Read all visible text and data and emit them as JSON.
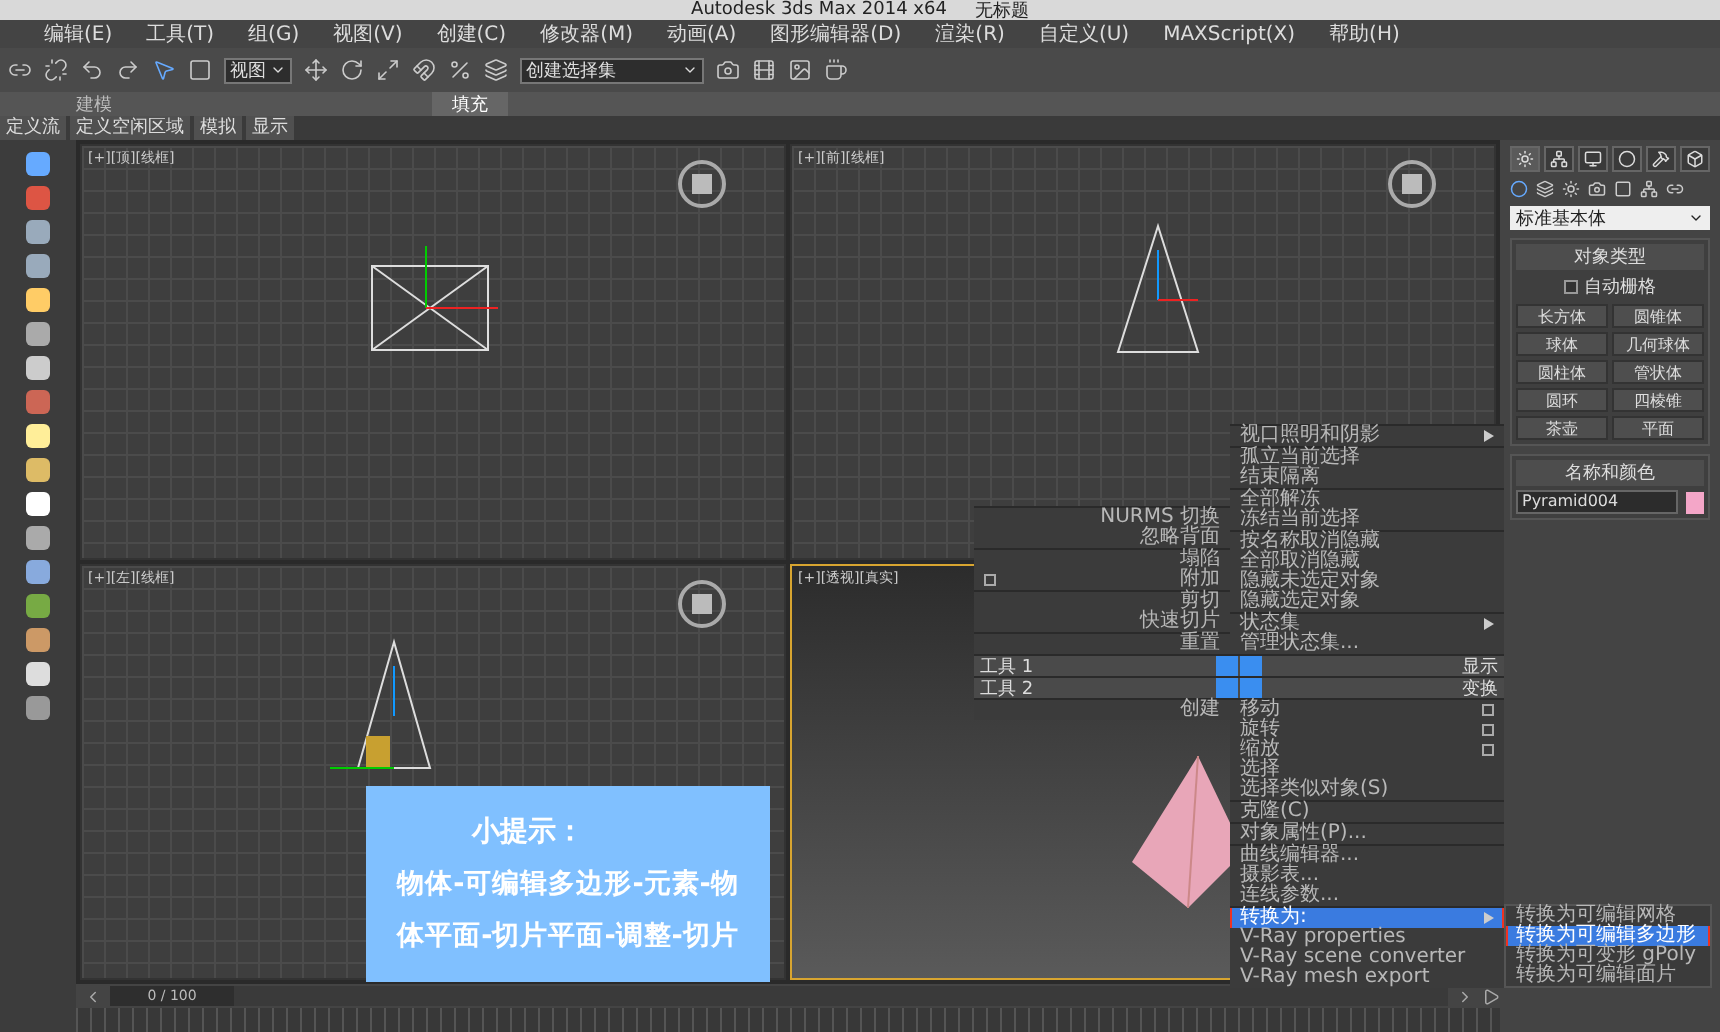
{
  "window": {
    "title": "Autodesk 3ds Max  2014 x64",
    "document": "无标题"
  },
  "menu_bar": [
    "编辑(E)",
    "工具(T)",
    "组(G)",
    "视图(V)",
    "创建(C)",
    "修改器(M)",
    "动画(A)",
    "图形编辑器(D)",
    "渲染(R)",
    "自定义(U)",
    "MAXScript(X)",
    "帮助(H)"
  ],
  "toolbar": {
    "view_dropdown": "视图",
    "selection_set": "创建选择集"
  },
  "ribbon_tabs": [
    {
      "label": "建模",
      "selected": false
    },
    {
      "label": "填充",
      "selected": true
    }
  ],
  "sub_tabs": [
    "定义流",
    "定义空闲区域",
    "模拟",
    "显示"
  ],
  "viewports": [
    {
      "label": "[+][顶][线框]",
      "active": false
    },
    {
      "label": "[+][前][线框]",
      "active": false
    },
    {
      "label": "[+][左][线框]",
      "active": false
    },
    {
      "label": "[+][透视][真实]",
      "active": true
    }
  ],
  "command_panel": {
    "tabs": [
      {
        "selected": true
      },
      {
        "selected": false
      },
      {
        "selected": false
      },
      {
        "selected": false
      },
      {
        "selected": false
      },
      {
        "selected": false
      }
    ],
    "category": "标准基本体",
    "object_type": {
      "title": "对象类型",
      "autogrid": {
        "label": "自动栅格",
        "checked": false
      },
      "buttons": [
        "长方体",
        "圆锥体",
        "球体",
        "几何球体",
        "圆柱体",
        "管状体",
        "圆环",
        "四棱锥",
        "茶壶",
        "平面"
      ]
    },
    "name_color": {
      "title": "名称和颜色",
      "name": "Pyramid004",
      "color": "#f4a6c8"
    }
  },
  "quad_menu": {
    "top_left": [
      [
        {
          "label": "NURMS 切换",
          "kind": "plain"
        },
        {
          "label": "忽略背面",
          "kind": "plain"
        }
      ],
      [
        {
          "label": "塌陷",
          "kind": "plain"
        },
        {
          "label": "附加",
          "kind": "option"
        }
      ],
      [
        {
          "label": "剪切",
          "kind": "plain"
        },
        {
          "label": "快速切片",
          "kind": "plain"
        }
      ],
      [
        {
          "label": "重置",
          "kind": "plain"
        }
      ]
    ],
    "top_right": [
      [
        {
          "label": "视口照明和阴影",
          "kind": "submenu"
        }
      ],
      [
        {
          "label": "孤立当前选择",
          "kind": "plain"
        },
        {
          "label": "结束隔离",
          "kind": "plain"
        }
      ],
      [
        {
          "label": "全部解冻",
          "kind": "plain"
        },
        {
          "label": "冻结当前选择",
          "kind": "plain"
        }
      ],
      [
        {
          "label": "按名称取消隐藏",
          "kind": "plain"
        },
        {
          "label": "全部取消隐藏",
          "kind": "plain"
        },
        {
          "label": "隐藏未选定对象",
          "kind": "plain"
        },
        {
          "label": "隐藏选定对象",
          "kind": "plain"
        }
      ],
      [
        {
          "label": "状态集",
          "kind": "submenu"
        },
        {
          "label": "管理状态集...",
          "kind": "plain"
        }
      ]
    ],
    "headers": [
      {
        "left": "工具 1",
        "right": "显示"
      },
      {
        "left": "工具 2",
        "right": "变换"
      }
    ],
    "bottom_left": [
      [
        {
          "label": "创建",
          "kind": "plain"
        }
      ]
    ],
    "bottom_right": [
      [
        {
          "label": "移动",
          "kind": "option",
          "selected": false
        },
        {
          "label": "旋转",
          "kind": "option",
          "selected": false
        },
        {
          "label": "缩放",
          "kind": "option",
          "selected": false
        },
        {
          "label": "选择",
          "kind": "plain",
          "selected": false
        },
        {
          "label": "选择类似对象(S)",
          "kind": "plain",
          "selected": false
        }
      ],
      [
        {
          "label": "克隆(C)",
          "kind": "plain",
          "selected": false
        }
      ],
      [
        {
          "label": "对象属性(P)...",
          "kind": "plain",
          "selected": false
        }
      ],
      [
        {
          "label": "曲线编辑器...",
          "kind": "plain",
          "selected": false
        },
        {
          "label": "摄影表...",
          "kind": "plain",
          "selected": false
        },
        {
          "label": "连线参数...",
          "kind": "plain",
          "selected": false
        }
      ],
      [
        {
          "label": "转换为:",
          "kind": "submenu",
          "selected": true
        },
        {
          "label": "V-Ray properties",
          "kind": "plain",
          "selected": false
        },
        {
          "label": "V-Ray scene converter",
          "kind": "plain",
          "selected": false
        },
        {
          "label": "V-Ray mesh export",
          "kind": "plain",
          "selected": false
        }
      ]
    ],
    "submenu": [
      {
        "label": "转换为可编辑网格",
        "selected": false
      },
      {
        "label": "转换为可编辑多边形",
        "selected": true
      },
      {
        "label": "转换为可变形 gPoly",
        "selected": false
      },
      {
        "label": "转换为可编辑面片",
        "selected": false
      }
    ]
  },
  "tip": {
    "title": "小提示：",
    "lines": [
      "物体-可编辑多边形-元素-物",
      "体平面-切片平面-调整-切片"
    ]
  },
  "timeline": {
    "frame": "0 / 100",
    "level": 0
  }
}
